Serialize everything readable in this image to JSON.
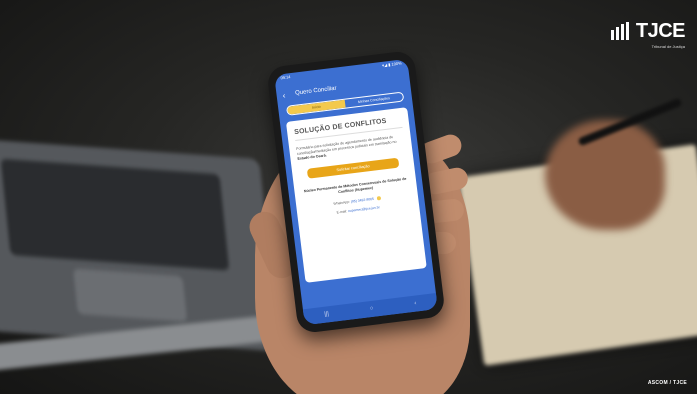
{
  "watermark": {
    "logo_text": "TJCE",
    "logo_subtitle": "Tribunal de Justiça",
    "credit": "ASCOM / TJCE"
  },
  "phone": {
    "status_time": "09:14",
    "status_right": "▾◢ ▮ 100%",
    "app_title": "Quero Conciliar",
    "tabs": [
      {
        "label": "Início",
        "active": true
      },
      {
        "label": "Minhas Conciliações",
        "active": false
      }
    ],
    "card": {
      "heading": "SOLUÇÃO DE CONFLITOS",
      "description": "Formulário para solicitação de agendamento de audiência de conciliação/mediação em processos judiciais em tramitação no",
      "description_bold": "Estado do Ceará.",
      "cta_label": "Solicitar conciliação",
      "center_name": "Núcleo Permanente de Métodos Consensuais de Solução de Conflitos (Nupemec)",
      "contacts": [
        {
          "label": "WhatsApp:",
          "value": "(85) 3492-8065"
        },
        {
          "label": "E-mail:",
          "value": "nupemec@tjce.jus.br"
        }
      ]
    },
    "nav_icons": [
      "menu-icon",
      "home-icon",
      "back-icon"
    ]
  }
}
